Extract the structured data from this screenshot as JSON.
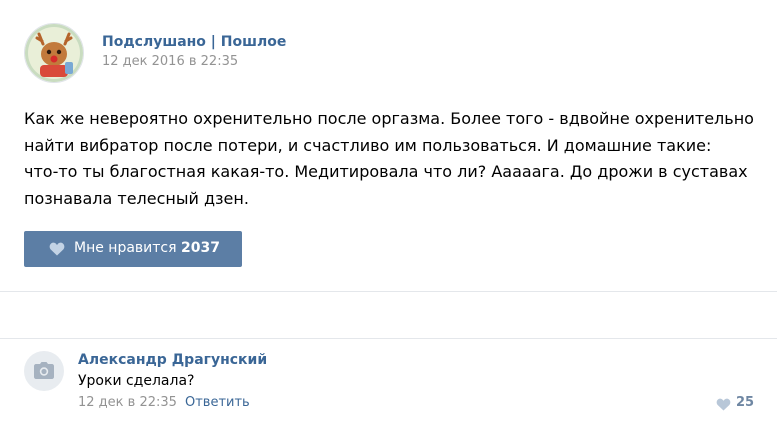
{
  "post": {
    "group_name": "Подслушано | Пошлое",
    "date": "12 дек 2016 в 22:35",
    "text_lines": [
      "Как же невероятно охренительно после оргазма. Более того - вдвойне охренительно",
      "найти вибратор после потери, и счастливо им пользоваться. И домашние такие:",
      "что-то ты благостная какая-то. Медитировала что ли? Ааааага. До дрожи в суставах",
      "познавала телесный дзен."
    ],
    "like_label": "Мне нравится",
    "like_count": "2037",
    "accent_color": "#5c7ea5",
    "avatar_icon": "reindeer-avatar"
  },
  "comment": {
    "author": "Александр Драгунский",
    "text": "Уроки сделала?",
    "date": "12 дек в 22:35",
    "reply_label": "Ответить",
    "like_count": "25",
    "avatar_icon": "camera-icon"
  }
}
